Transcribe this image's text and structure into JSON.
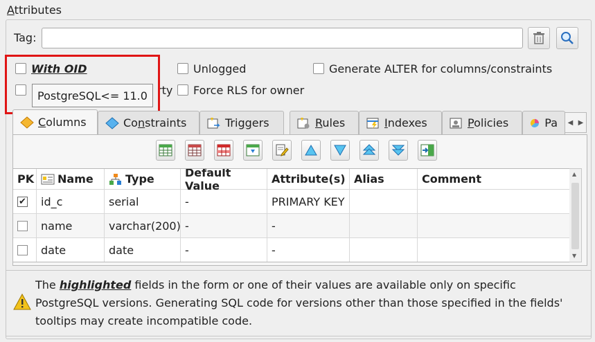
{
  "group": {
    "title_accel": "A",
    "title_rest": "ttributes"
  },
  "tag": {
    "label": "Tag:",
    "value": "",
    "placeholder": ""
  },
  "options": {
    "with_oid": "With OID",
    "unlogged": "Unlogged",
    "generate_alter": "Generate ALTER for columns/constraints",
    "partial_label": "rty",
    "force_rls": "Force RLS for owner"
  },
  "tooltip": {
    "text": "PostgreSQL<= 11.0"
  },
  "tabs": [
    {
      "accel": "C",
      "rest": "olumns",
      "icon": "columns-icon"
    },
    {
      "pre": "Co",
      "accel": "n",
      "rest": "straints",
      "icon": "constraints-icon"
    },
    {
      "pre": "Trig",
      "accel": "g",
      "rest": "ers",
      "icon": "triggers-icon"
    },
    {
      "accel": "R",
      "rest": "ules",
      "icon": "rules-icon"
    },
    {
      "accel": "I",
      "rest": "ndexes",
      "icon": "indexes-icon"
    },
    {
      "accel": "P",
      "rest": "olicies",
      "icon": "policies-icon"
    },
    {
      "pre": "Pa",
      "accel": "",
      "rest": "",
      "icon": "partitions-icon"
    }
  ],
  "table": {
    "headers": [
      "PK",
      "Name",
      "Type",
      "Default Value",
      "Attribute(s)",
      "Alias",
      "Comment"
    ],
    "rows": [
      {
        "pk": true,
        "name": "id_c",
        "type": "serial",
        "default": "-",
        "attr": "PRIMARY KEY",
        "alias": "",
        "comment": ""
      },
      {
        "pk": false,
        "name": "name",
        "type": "varchar(200)",
        "default": "-",
        "attr": "-",
        "alias": "",
        "comment": ""
      },
      {
        "pk": false,
        "name": "date",
        "type": "date",
        "default": "-",
        "attr": "-",
        "alias": "",
        "comment": ""
      }
    ]
  },
  "notice": {
    "pre": "The ",
    "highlight": "highlighted",
    "post": " fields in the form or one of their values are available only on specific PostgreSQL versions. Generating SQL code for versions other than those specified in the fields' tooltips may create incompatible code."
  },
  "colors": {
    "highlight_box": "#e01515",
    "accent_blue": "#2a7fd4",
    "warning": "#f2c21b"
  }
}
